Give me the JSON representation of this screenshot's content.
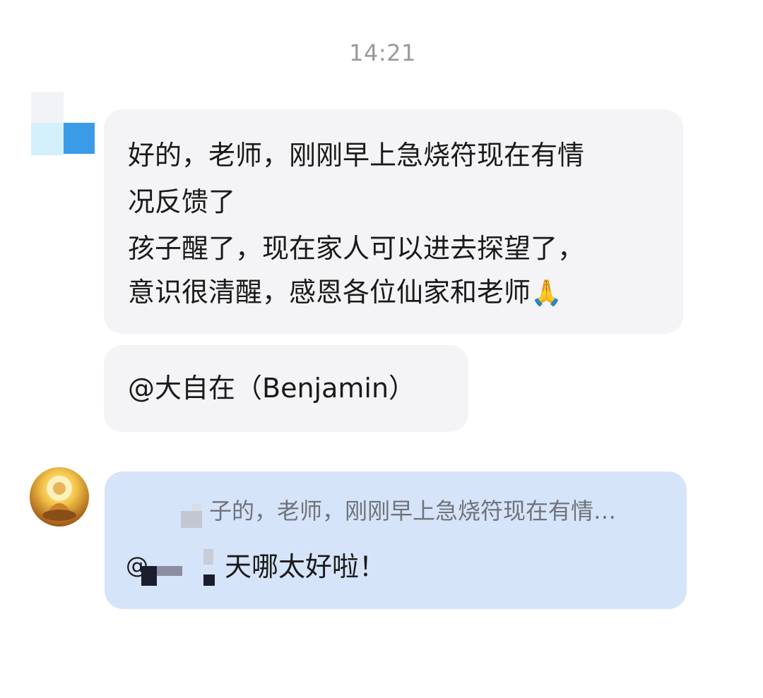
{
  "timestamp": "14:21",
  "message_main": {
    "lines": [
      "好的，老师，刚刚早上急烧符现在有情",
      "况反馈了",
      "孩子醒了，现在家人可以进去探望了，",
      "意识很清醒，感恩各位仙家和老师"
    ],
    "emoji": "🙏"
  },
  "message_mention": {
    "text": "@大自在（Benjamin）"
  },
  "reply": {
    "quote": "子的，老师，刚刚早上急烧符现在有情…",
    "text": "天哪太好啦！",
    "mention_prefix": "@"
  },
  "colors": {
    "incoming_bubble": "#f4f4f6",
    "reply_bubble": "#d6e4fa",
    "timestamp": "#9a9a9a"
  },
  "icons": {
    "sender_avatar": "pixelated-avatar",
    "self_avatar": "golden-buddha-avatar"
  }
}
